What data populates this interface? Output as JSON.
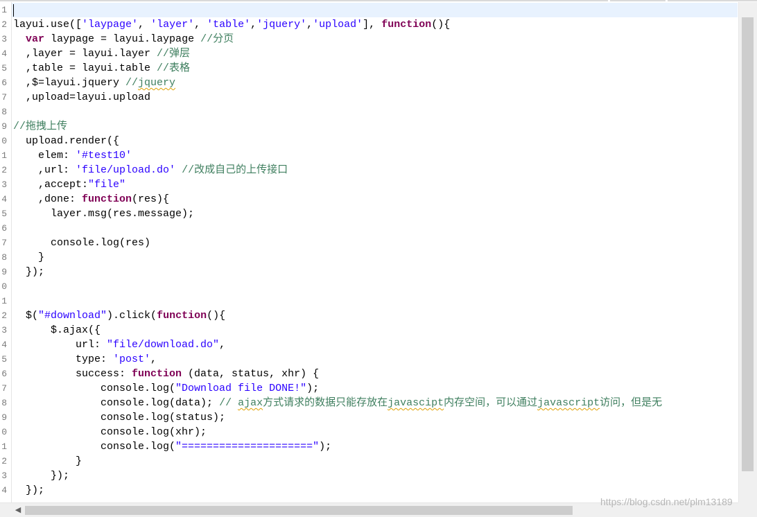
{
  "editor": {
    "line_numbers": [
      "1",
      "2",
      "3",
      "4",
      "5",
      "6",
      "7",
      "8",
      "9",
      "0",
      "1",
      "2",
      "3",
      "4",
      "5",
      "6",
      "7",
      "8",
      "9",
      "0",
      "1",
      "2",
      "3",
      "4",
      "5",
      "6",
      "7",
      "8",
      "9",
      "0",
      "1",
      "2",
      "3",
      "4"
    ],
    "lines": [
      [],
      [
        [
          "layui.use([",
          "plain"
        ],
        [
          "'laypage'",
          "str"
        ],
        [
          ", ",
          "plain"
        ],
        [
          "'layer'",
          "str"
        ],
        [
          ", ",
          "plain"
        ],
        [
          "'table'",
          "str"
        ],
        [
          ",",
          "plain"
        ],
        [
          "'jquery'",
          "str"
        ],
        [
          ",",
          "plain"
        ],
        [
          "'upload'",
          "str"
        ],
        [
          "], ",
          "plain"
        ],
        [
          "function",
          "kw"
        ],
        [
          "(){",
          "plain"
        ]
      ],
      [
        [
          "  ",
          "plain"
        ],
        [
          "var",
          "kw"
        ],
        [
          " laypage = layui.laypage ",
          "plain"
        ],
        [
          "//分页",
          "cm"
        ]
      ],
      [
        [
          "  ,layer = layui.layer ",
          "plain"
        ],
        [
          "//弹层",
          "cm"
        ]
      ],
      [
        [
          "  ,table = layui.table ",
          "plain"
        ],
        [
          "//表格",
          "cm"
        ]
      ],
      [
        [
          "  ,$=layui.jquery ",
          "plain"
        ],
        [
          "//",
          "cm"
        ],
        [
          "jquery",
          "cm squiggle"
        ]
      ],
      [
        [
          "  ,upload=layui.upload",
          "plain"
        ]
      ],
      [],
      [
        [
          "//拖拽上传",
          "cm"
        ]
      ],
      [
        [
          "  upload.render({",
          "plain"
        ]
      ],
      [
        [
          "    elem: ",
          "plain"
        ],
        [
          "'#test10'",
          "str"
        ]
      ],
      [
        [
          "    ,url: ",
          "plain"
        ],
        [
          "'file/upload.do'",
          "str"
        ],
        [
          " ",
          "plain"
        ],
        [
          "//改成自己的上传接口",
          "cm"
        ]
      ],
      [
        [
          "    ,accept:",
          "plain"
        ],
        [
          "\"file\"",
          "str"
        ]
      ],
      [
        [
          "    ,done: ",
          "plain"
        ],
        [
          "function",
          "kw"
        ],
        [
          "(res){",
          "plain"
        ]
      ],
      [
        [
          "      layer.msg(res.message);",
          "plain"
        ]
      ],
      [],
      [
        [
          "      console.log(res)",
          "plain"
        ]
      ],
      [
        [
          "    }",
          "plain"
        ]
      ],
      [
        [
          "  });",
          "plain"
        ]
      ],
      [],
      [],
      [
        [
          "  $(",
          "plain"
        ],
        [
          "\"#download\"",
          "str"
        ],
        [
          ").click(",
          "plain"
        ],
        [
          "function",
          "kw"
        ],
        [
          "(){",
          "plain"
        ]
      ],
      [
        [
          "      $.ajax({",
          "plain"
        ]
      ],
      [
        [
          "          url: ",
          "plain"
        ],
        [
          "\"file/download.do\"",
          "str"
        ],
        [
          ",",
          "plain"
        ]
      ],
      [
        [
          "          type: ",
          "plain"
        ],
        [
          "'post'",
          "str"
        ],
        [
          ",",
          "plain"
        ]
      ],
      [
        [
          "          success: ",
          "plain"
        ],
        [
          "function",
          "kw"
        ],
        [
          " (data, status, xhr) {",
          "plain"
        ]
      ],
      [
        [
          "              console.log(",
          "plain"
        ],
        [
          "\"Download file DONE!\"",
          "str"
        ],
        [
          ");",
          "plain"
        ]
      ],
      [
        [
          "              console.log(data); ",
          "plain"
        ],
        [
          "// ",
          "cm"
        ],
        [
          "ajax",
          "cm squiggle"
        ],
        [
          "方式请求的数据只能存放在",
          "cm"
        ],
        [
          "javascipt",
          "cm squiggle"
        ],
        [
          "内存空间，可以通过",
          "cm"
        ],
        [
          "javascript",
          "cm squiggle"
        ],
        [
          "访问，但是无",
          "cm"
        ]
      ],
      [
        [
          "              console.log(status);",
          "plain"
        ]
      ],
      [
        [
          "              console.log(xhr);",
          "plain"
        ]
      ],
      [
        [
          "              console.log(",
          "plain"
        ],
        [
          "\"=====================\"",
          "str"
        ],
        [
          ");",
          "plain"
        ]
      ],
      [
        [
          "          }",
          "plain"
        ]
      ],
      [
        [
          "      });",
          "plain"
        ]
      ],
      [
        [
          "  });",
          "plain"
        ]
      ]
    ]
  },
  "watermark": "https://blog.csdn.net/plm13189"
}
